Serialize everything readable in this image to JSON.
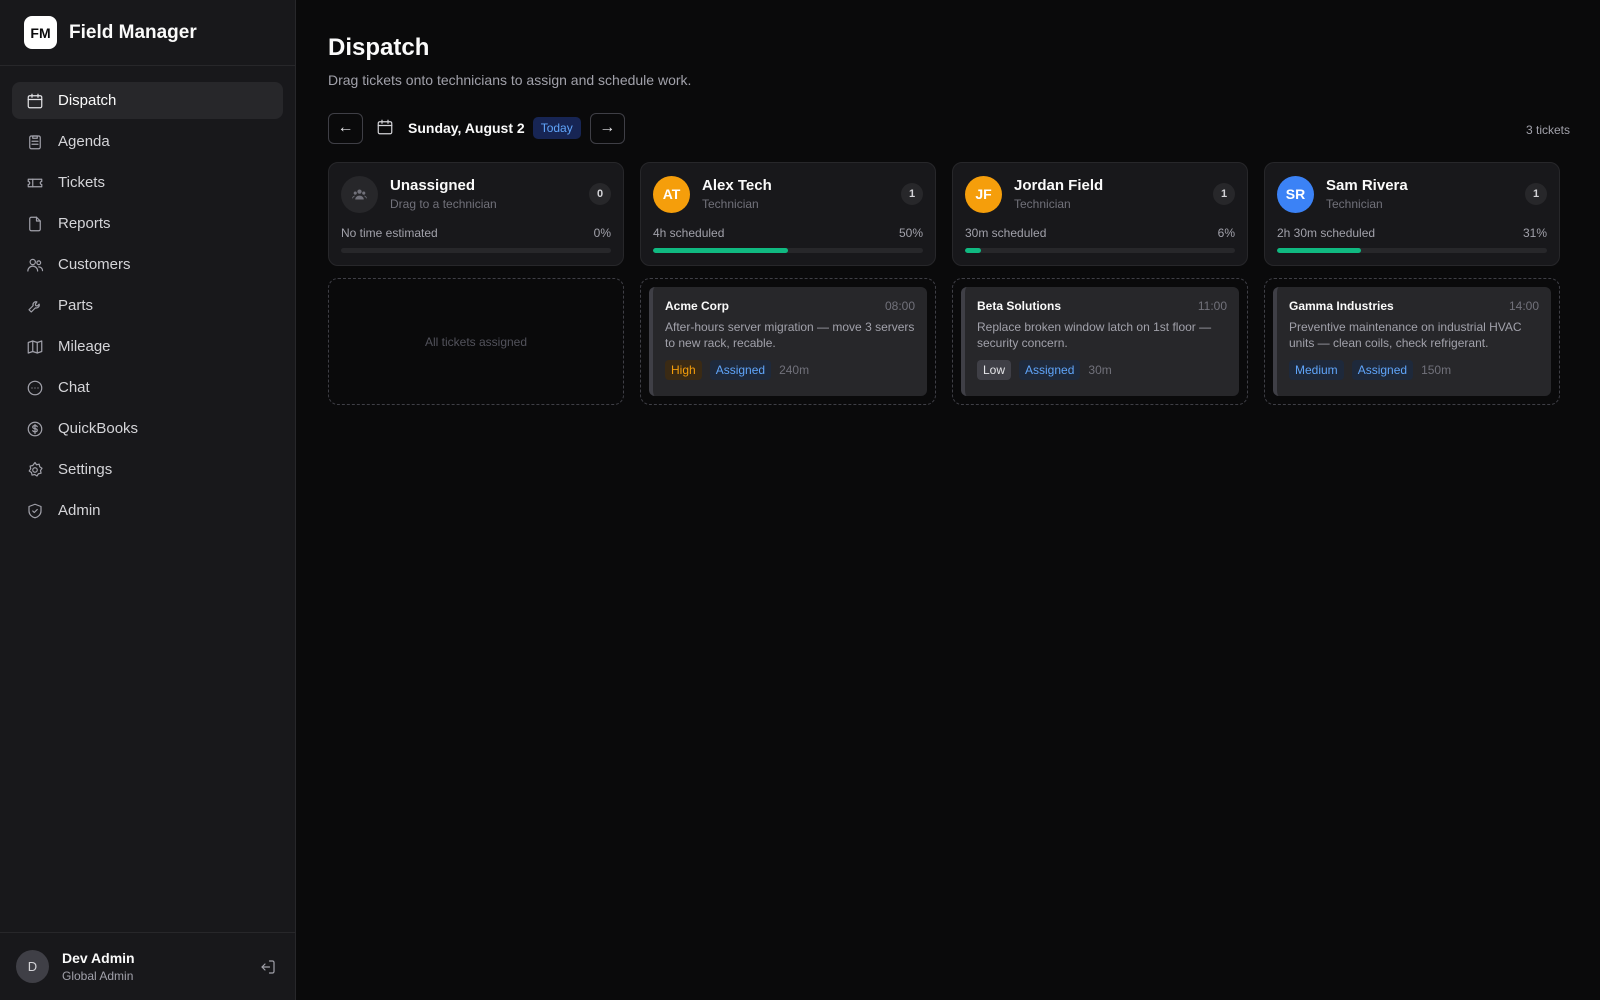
{
  "app": {
    "logo": "FM",
    "name": "Field Manager"
  },
  "sidebar": {
    "items": [
      {
        "label": "Dispatch",
        "icon": "calendar-icon",
        "active": true
      },
      {
        "label": "Agenda",
        "icon": "clipboard-icon",
        "active": false
      },
      {
        "label": "Tickets",
        "icon": "ticket-icon",
        "active": false
      },
      {
        "label": "Reports",
        "icon": "file-icon",
        "active": false
      },
      {
        "label": "Customers",
        "icon": "users-icon",
        "active": false
      },
      {
        "label": "Parts",
        "icon": "wrench-icon",
        "active": false
      },
      {
        "label": "Mileage",
        "icon": "map-icon",
        "active": false
      },
      {
        "label": "Chat",
        "icon": "chat-icon",
        "active": false
      },
      {
        "label": "QuickBooks",
        "icon": "dollar-icon",
        "active": false
      },
      {
        "label": "Settings",
        "icon": "gear-icon",
        "active": false
      },
      {
        "label": "Admin",
        "icon": "shield-icon",
        "active": false
      }
    ]
  },
  "user": {
    "initial": "D",
    "name": "Dev Admin",
    "role": "Global Admin"
  },
  "page": {
    "title": "Dispatch",
    "subtitle": "Drag tickets onto technicians to assign and schedule work."
  },
  "toolbar": {
    "prev": "←",
    "next": "→",
    "date": "Sunday, August 2",
    "today": "Today",
    "ticket_count": "3 tickets"
  },
  "columns": [
    {
      "name": "Unassigned",
      "role": "Drag to a technician",
      "count": "0",
      "scheduled": "No time estimated",
      "percent": "0%",
      "fill": 0,
      "empty_text": "All tickets assigned",
      "tickets": []
    },
    {
      "initials": "AT",
      "avatar_color": "#f59e0b",
      "name": "Alex Tech",
      "role": "Technician",
      "count": "1",
      "scheduled": "4h scheduled",
      "percent": "50%",
      "fill": 50,
      "tickets": [
        {
          "customer": "Acme Corp",
          "time": "08:00",
          "description": "After-hours server migration — move 3 servers to new rack, recable.",
          "priority": "High",
          "priority_class": "tag-high",
          "status": "Assigned",
          "duration": "240m"
        }
      ]
    },
    {
      "initials": "JF",
      "avatar_color": "#f59e0b",
      "name": "Jordan Field",
      "role": "Technician",
      "count": "1",
      "scheduled": "30m scheduled",
      "percent": "6%",
      "fill": 6,
      "tickets": [
        {
          "customer": "Beta Solutions",
          "time": "11:00",
          "description": "Replace broken window latch on 1st floor — security concern.",
          "priority": "Low",
          "priority_class": "tag-low",
          "status": "Assigned",
          "duration": "30m"
        }
      ]
    },
    {
      "initials": "SR",
      "avatar_color": "#3b82f6",
      "name": "Sam Rivera",
      "role": "Technician",
      "count": "1",
      "scheduled": "2h 30m scheduled",
      "percent": "31%",
      "fill": 31,
      "tickets": [
        {
          "customer": "Gamma Industries",
          "time": "14:00",
          "description": "Preventive maintenance on industrial HVAC units — clean coils, check refrigerant.",
          "priority": "Medium",
          "priority_class": "tag-medium",
          "status": "Assigned",
          "duration": "150m"
        }
      ]
    }
  ]
}
